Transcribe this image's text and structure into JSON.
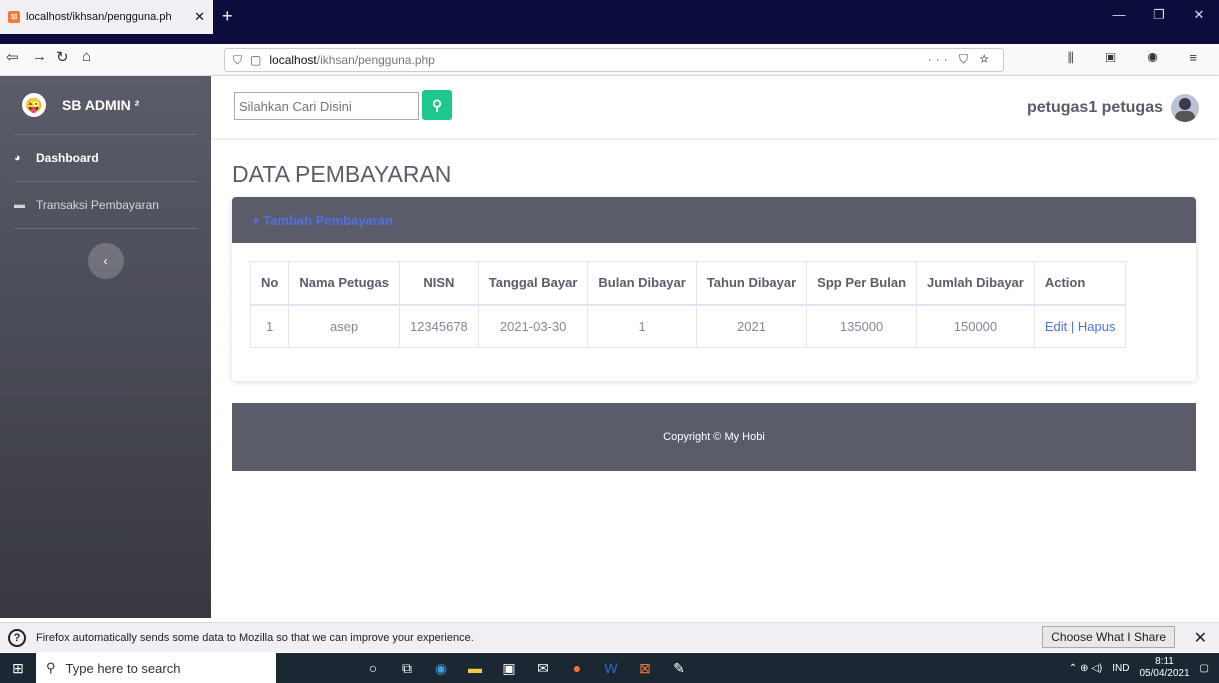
{
  "browser": {
    "tab_title": "localhost/ikhsan/pengguna.ph",
    "url_host": "localhost",
    "url_path": "/ikhsan/pengguna.php"
  },
  "sidebar": {
    "brand": "SB ADMIN ²",
    "items": [
      {
        "label": "Dashboard"
      },
      {
        "label": "Transaksi Pembayaran"
      }
    ]
  },
  "topbar": {
    "search_placeholder": "Silahkan Cari Disini",
    "user_name": "petugas1 petugas"
  },
  "main": {
    "title": "DATA PEMBAYARAN",
    "card_header": "+ Tambah Pembayaran",
    "table": {
      "headers": [
        "No",
        "Nama Petugas",
        "NISN",
        "Tanggal Bayar",
        "Bulan Dibayar",
        "Tahun Dibayar",
        "Spp Per Bulan",
        "Jumlah Dibayar",
        "Action"
      ],
      "rows": [
        {
          "no": "1",
          "nama": "asep",
          "nisn": "12345678",
          "tanggal": "2021-03-30",
          "bulan": "1",
          "tahun": "2021",
          "spp": "135000",
          "jumlah": "150000",
          "edit": "Edit",
          "sep": " | ",
          "hapus": "Hapus"
        }
      ]
    }
  },
  "footer": {
    "text": "Copyright © My Hobi"
  },
  "notification": {
    "text": "Firefox automatically sends some data to Mozilla so that we can improve your experience.",
    "button": "Choose What I Share"
  },
  "taskbar": {
    "search_placeholder": "Type here to search",
    "lang": "IND",
    "time": "8:11",
    "date": "05/04/2021"
  },
  "colors": {
    "sidebar": "#4e5060",
    "accent": "#4e73df",
    "search_button": "#1cc88a",
    "card_header": "#5a5c69"
  }
}
